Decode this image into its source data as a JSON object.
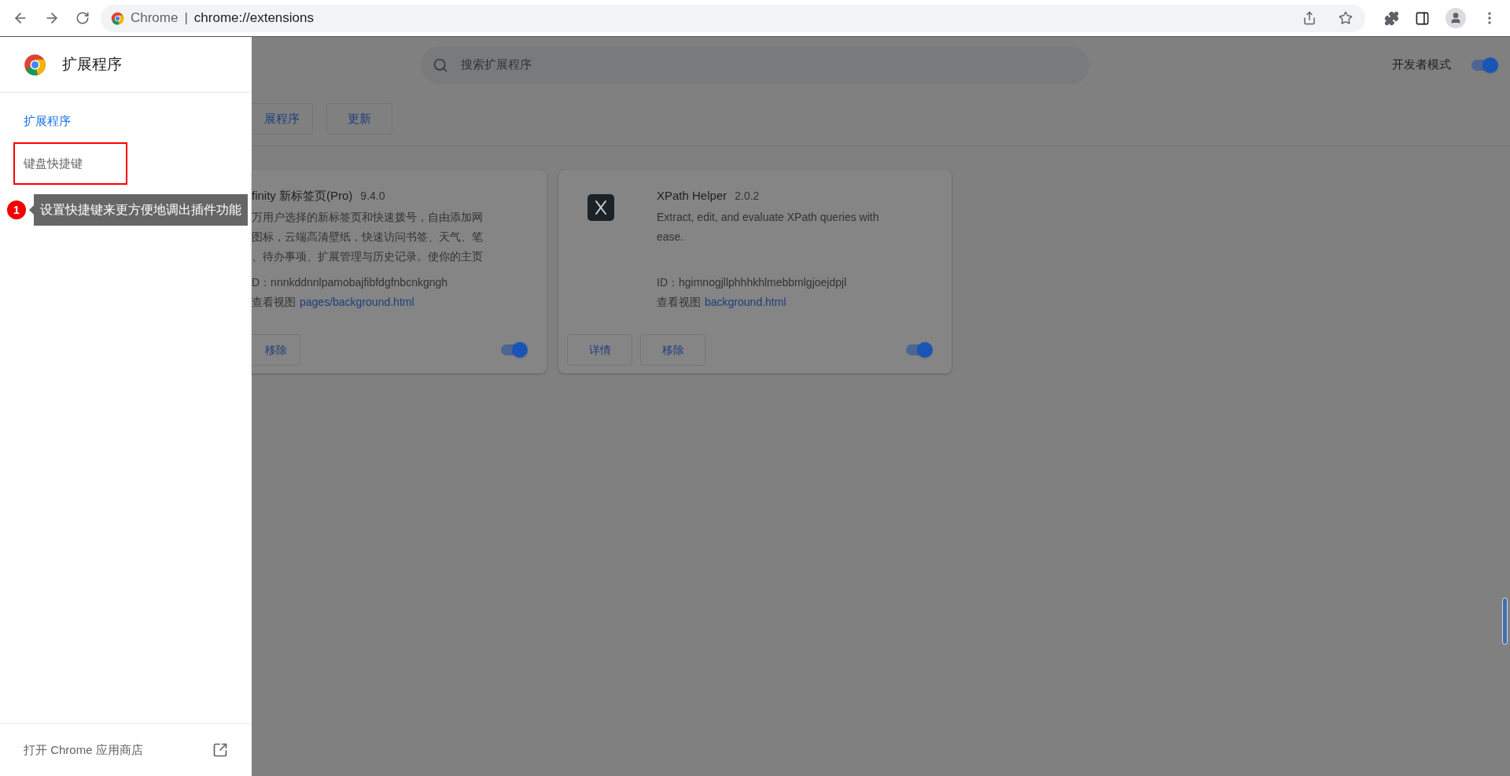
{
  "browser": {
    "site_label": "Chrome",
    "separator": "|",
    "url": "chrome://extensions"
  },
  "sidebar": {
    "title": "扩展程序",
    "items": [
      {
        "label": "扩展程序",
        "selected": true,
        "outlined": false
      },
      {
        "label": "键盘快捷键",
        "selected": false,
        "outlined": true
      }
    ],
    "footer_link": "打开 Chrome 应用商店"
  },
  "annotation": {
    "number": "1",
    "text": "设置快捷键来更方便地调出插件功能"
  },
  "header": {
    "search_placeholder": "搜索扩展程序",
    "dev_mode": {
      "label": "开发者模式",
      "on": true
    }
  },
  "toolbar_buttons": [
    "展程序",
    "更新"
  ],
  "extensions": [
    {
      "name": "finity 新标签页(Pro)",
      "version": "9.4.0",
      "has_icon": false,
      "description_lines": [
        "万用户选择的新标签页和快速拨号，自由添加网",
        "图标，云端高清壁纸，快速访问书签、天气、笔",
        "、待办事项、扩展管理与历史记录。使你的主页"
      ],
      "id_line": "D：nnnkddnnlpamobajfibfdgfnbcnkgngh",
      "view_label": "查看视图",
      "view_link": "pages/background.html",
      "buttons": [
        "移除"
      ],
      "enabled": true
    },
    {
      "name": "XPath Helper",
      "version": "2.0.2",
      "has_icon": true,
      "description_lines": [
        "Extract, edit, and evaluate XPath queries with",
        "ease."
      ],
      "id_line": "ID：hgimnogjllphhhkhlmebbmlgjoejdpjl",
      "view_label": "查看视图",
      "view_link": "background.html",
      "buttons": [
        "详情",
        "移除"
      ],
      "enabled": true
    }
  ]
}
